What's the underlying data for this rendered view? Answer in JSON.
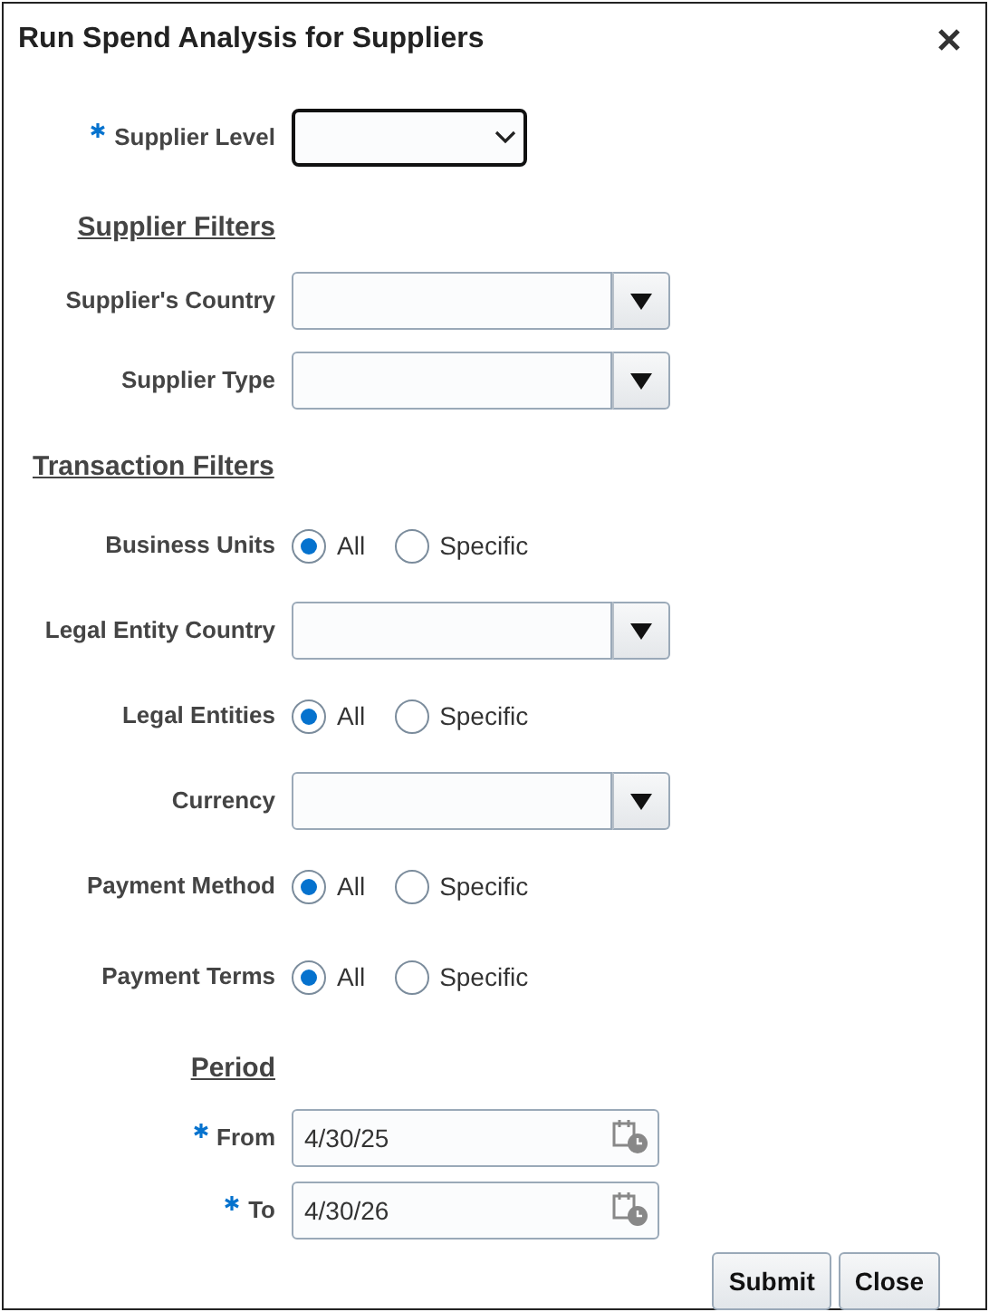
{
  "window": {
    "title": "Run Spend Analysis for Suppliers"
  },
  "fields": [
    {
      "kind": "select",
      "label": "Supplier Level",
      "required": true
    },
    {
      "kind": "heading",
      "label": "Supplier Filters"
    },
    {
      "kind": "combo",
      "label": "Supplier's Country"
    },
    {
      "kind": "combo",
      "label": "Supplier Type"
    },
    {
      "kind": "heading",
      "label": "Transaction Filters",
      "wide": true
    },
    {
      "kind": "radio",
      "label": "Business Units",
      "options": [
        {
          "label": "All",
          "selected": true
        },
        {
          "label": "Specific",
          "selected": false
        }
      ]
    },
    {
      "kind": "combo",
      "label": "Legal Entity Country"
    },
    {
      "kind": "radio",
      "label": "Legal Entities",
      "options": [
        {
          "label": "All",
          "selected": true
        },
        {
          "label": "Specific",
          "selected": false
        }
      ]
    },
    {
      "kind": "combo",
      "label": "Currency"
    },
    {
      "kind": "radio",
      "label": "Payment Method",
      "options": [
        {
          "label": "All",
          "selected": true
        },
        {
          "label": "Specific",
          "selected": false
        }
      ]
    },
    {
      "kind": "radio",
      "label": "Payment Terms",
      "options": [
        {
          "label": "All",
          "selected": true
        },
        {
          "label": "Specific",
          "selected": false
        }
      ]
    },
    {
      "kind": "heading",
      "label": "Period"
    },
    {
      "kind": "date",
      "label": "From",
      "required": true,
      "value": "4/30/25"
    },
    {
      "kind": "date",
      "label": "To",
      "required": true,
      "value": "4/30/26"
    }
  ],
  "buttons": [
    "Submit",
    "Close"
  ]
}
